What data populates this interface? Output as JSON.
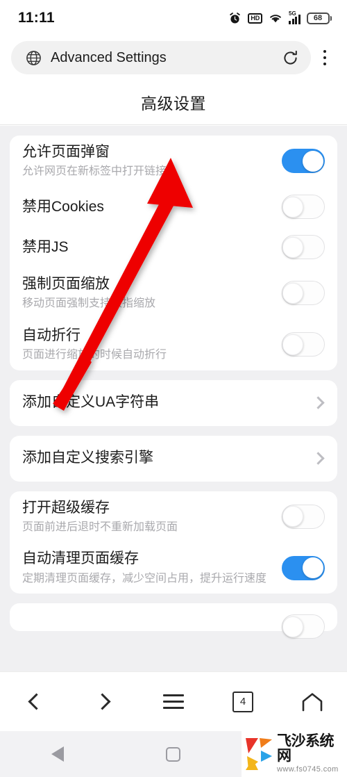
{
  "status_bar": {
    "time": "11:11",
    "battery_level": "68",
    "network_label": "5G",
    "hd_label": "HD",
    "icons": [
      "alarm-icon",
      "hd-icon",
      "wifi-icon",
      "signal-5g-icon",
      "battery-icon"
    ]
  },
  "browser": {
    "address_text": "Advanced Settings",
    "globe_icon": "globe-icon",
    "refresh_icon": "refresh-icon",
    "menu_icon": "kebab-menu-icon"
  },
  "page": {
    "title": "高级设置"
  },
  "groups": [
    {
      "type": "toggles",
      "rows": [
        {
          "title": "允许页面弹窗",
          "subtitle": "允许网页在新标签中打开链接",
          "state": "on"
        },
        {
          "title": "禁用Cookies",
          "subtitle": "",
          "state": "off"
        },
        {
          "title": "禁用JS",
          "subtitle": "",
          "state": "off"
        },
        {
          "title": "强制页面缩放",
          "subtitle": "移动页面强制支持双指缩放",
          "state": "off"
        },
        {
          "title": "自动折行",
          "subtitle": "页面进行缩放的时候自动折行",
          "state": "off"
        }
      ]
    },
    {
      "type": "nav",
      "rows": [
        {
          "title": "添加自定义UA字符串",
          "subtitle": "",
          "chevron": "chevron-right-icon"
        }
      ]
    },
    {
      "type": "nav",
      "rows": [
        {
          "title": "添加自定义搜索引擎",
          "subtitle": "",
          "chevron": "chevron-right-icon"
        }
      ]
    },
    {
      "type": "toggles",
      "rows": [
        {
          "title": "打开超级缓存",
          "subtitle": "页面前进后退时不重新加载页面",
          "state": "off"
        },
        {
          "title": "自动清理页面缓存",
          "subtitle": "定期清理页面缓存，减少空间占用，提升运行速度",
          "state": "on"
        }
      ]
    }
  ],
  "annotation": {
    "color": "#ee0000",
    "kind": "arrow",
    "points_to": "允许页面弹窗 toggle"
  },
  "toolbar": {
    "back_icon": "chevron-left-icon",
    "forward_icon": "chevron-right-icon",
    "menu_icon": "hamburger-menu-icon",
    "tab_count": "4",
    "home_icon": "home-icon"
  },
  "system_nav": {
    "back_icon": "triangle-back-icon",
    "home_icon": "square-home-icon"
  },
  "watermark": {
    "site_name": "飞沙系统网",
    "url": "www.fs0745.com"
  },
  "colors": {
    "toggle_on": "#2b90f0",
    "page_bg": "#f0f0f2",
    "card_bg": "#ffffff",
    "annotation_red": "#ee0000"
  }
}
